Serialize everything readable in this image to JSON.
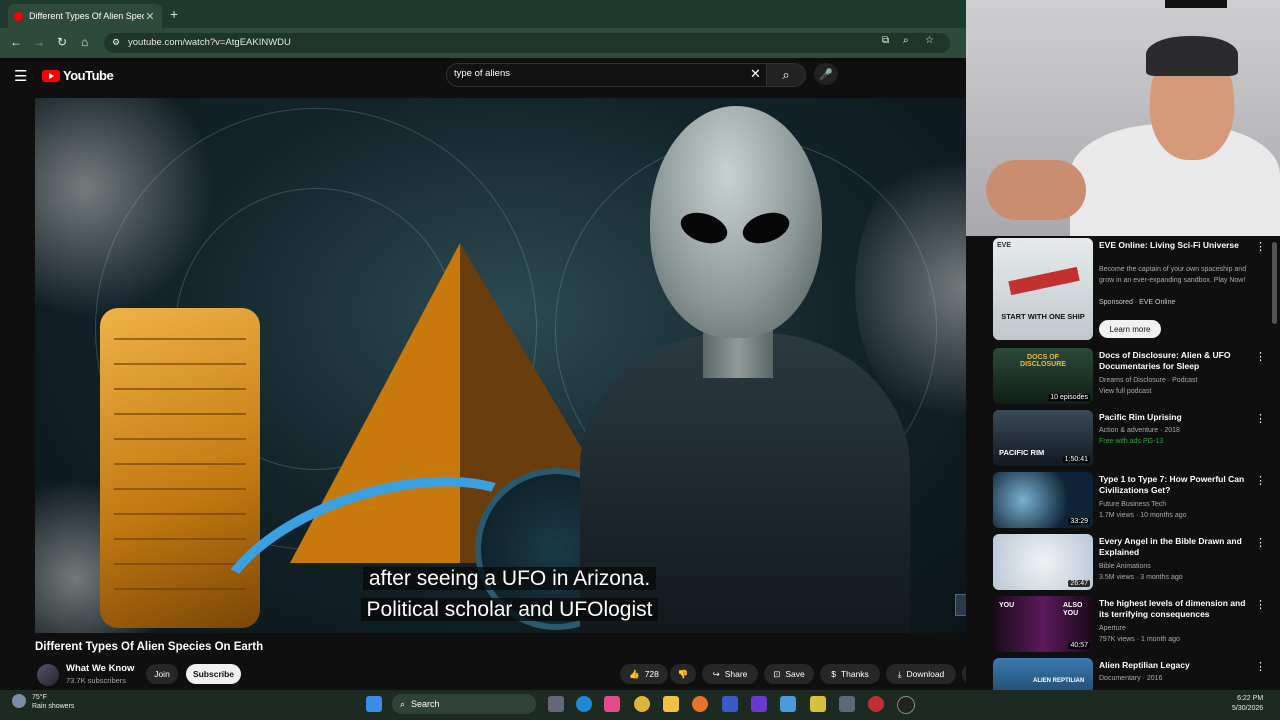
{
  "browser": {
    "tab_title": "Different Types Of Alien Species",
    "new_tab": "+",
    "url": "youtube.com/watch?v=AtgEAKINWDU"
  },
  "youtube": {
    "logo_text": "YouTube",
    "search_query": "type of aliens",
    "clear": "✕"
  },
  "video": {
    "subtitle_line1": "after seeing a UFO in Arizona.",
    "subtitle_line2": "Political scholar and UFOlogist",
    "title": "Different Types Of Alien Species On Earth",
    "channel": "What We Know",
    "subscribers": "73.7K subscribers",
    "join": "Join",
    "subscribe": "Subscribe",
    "likes": "728",
    "share": "Share",
    "save": "Save",
    "thanks": "Thanks",
    "download": "Download",
    "more": "•••"
  },
  "sidebar": {
    "items": [
      {
        "title": "EVE Online: Living Sci-Fi Universe",
        "desc": "Become the captain of your own spaceship and grow in an ever-expanding sandbox. Play Now!",
        "meta": "Sponsored · EVE Online",
        "thumb_text": "START WITH ONE SHIP",
        "thumb_brand": "EVE",
        "cta": "Learn more",
        "thumb_color": "#d8dde0"
      },
      {
        "title": "Docs of Disclosure: Alien & UFO Documentaries for Sleep",
        "meta1": "Dreams of Disclosure · Podcast",
        "meta2": "View full podcast",
        "thumb_text": "DOCS OF DISCLOSURE",
        "thumb_badge": "10 episodes",
        "thumb_color": "#1d3a2a"
      },
      {
        "title": "Pacific Rim Uprising",
        "meta1": "Action & adventure · 2018",
        "meta2": "Free with ads  PG-13",
        "thumb_text": "PACIFIC RIM",
        "duration": "1:50:41",
        "thumb_color": "#24323e"
      },
      {
        "title": "Type 1 to Type 7: How Powerful Can Civilizations Get?",
        "meta1": "Future Business Tech",
        "meta2": "1.7M views · 10 months ago",
        "duration": "33:29",
        "thumb_color": "#1f4a6a"
      },
      {
        "title": "Every Angel in the Bible Drawn and Explained",
        "meta1": "Bible Animations",
        "meta2": "3.5M views · 3 months ago",
        "duration": "26:47",
        "thumb_color": "#c9d4dc"
      },
      {
        "title": "The highest levels of dimension and its terrifying consequences",
        "meta1": "Aperture",
        "meta2": "797K views · 1 month ago",
        "thumb_text_left": "YOU",
        "thumb_text_right": "ALSO YOU",
        "duration": "40:57",
        "thumb_color": "#2a0f2a"
      },
      {
        "title": "Alien Reptilian Legacy",
        "meta1": "Documentary · 2016",
        "meta2": "",
        "thumb_text": "ALIEN REPTILIAN",
        "thumb_color": "#2a5a8a"
      }
    ]
  },
  "taskbar": {
    "temp": "75°F",
    "weather": "Rain showers",
    "search": "Search",
    "time": "6:22 PM",
    "date": "5/30/2026"
  }
}
